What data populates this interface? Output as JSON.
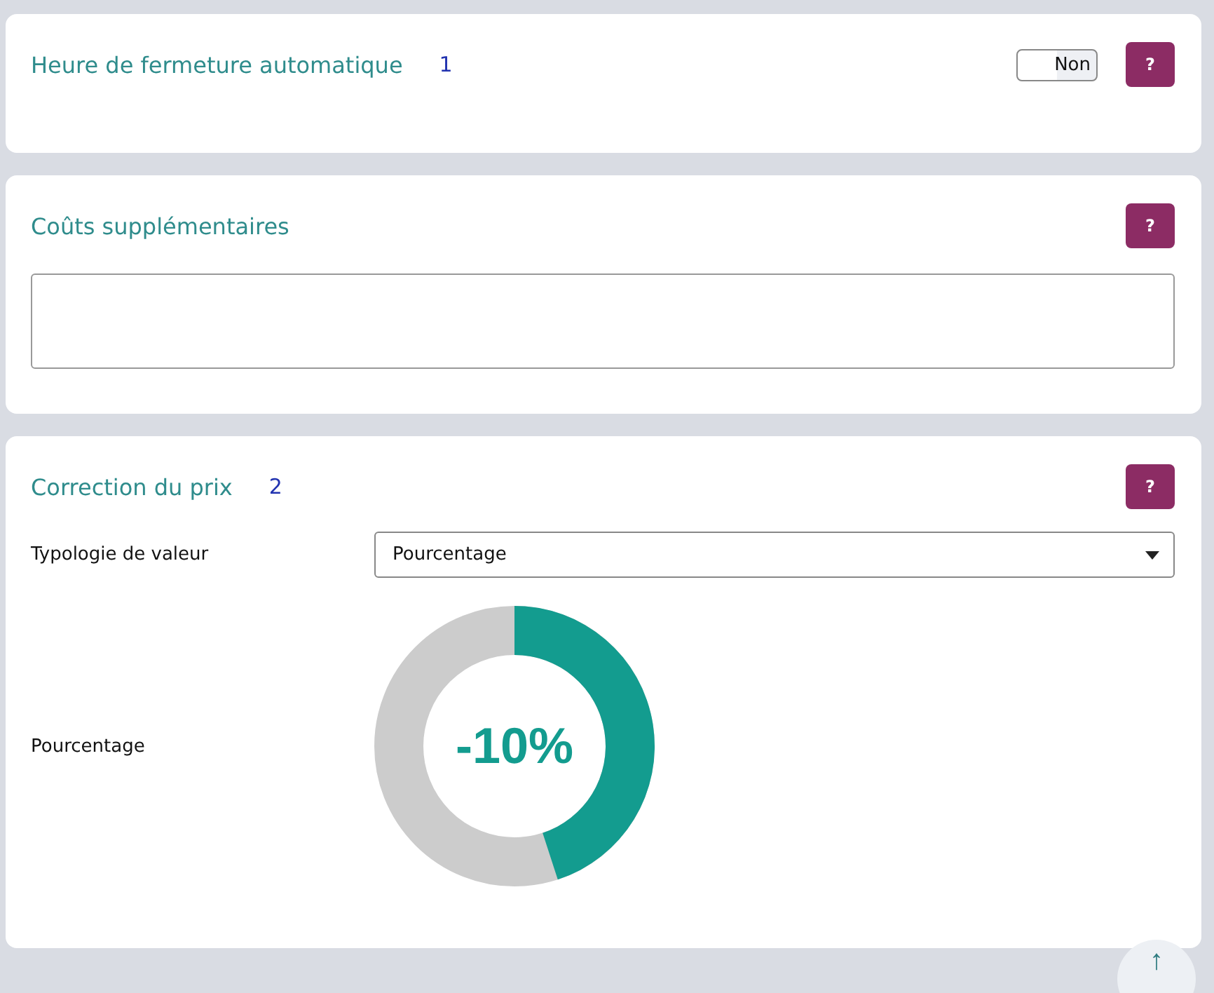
{
  "sections": [
    {
      "kind": "toggle",
      "title": "Heure de fermeture automatique",
      "number": "1",
      "toggle": {
        "label": "Non",
        "on": false
      },
      "help": "?"
    },
    {
      "kind": "textarea",
      "title": "Coûts supplémentaires",
      "help": "?"
    },
    {
      "kind": "correction",
      "title": "Correction du prix",
      "number": "2",
      "help": "?",
      "select_label": "Typologie de valeur",
      "select_value": "Pourcentage",
      "dial_label": "Pourcentage",
      "dial": {
        "reading": "-10%",
        "level": 0.45
      }
    }
  ],
  "scroll_top": "↑"
}
